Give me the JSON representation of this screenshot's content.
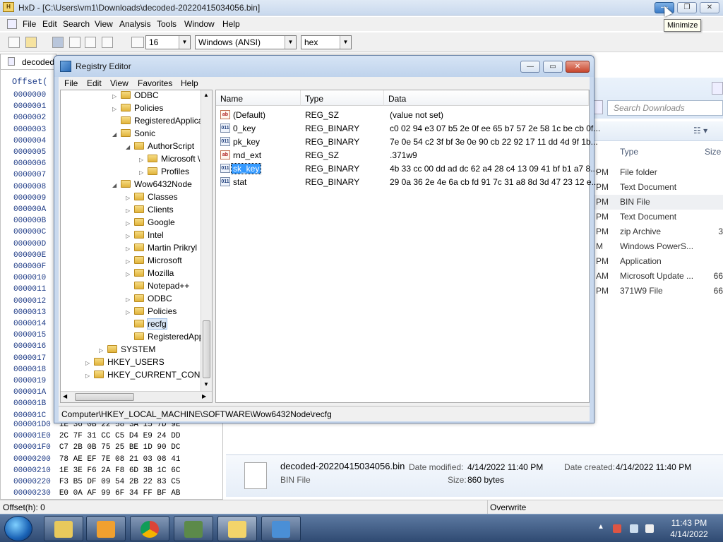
{
  "hxd": {
    "title": "HxD - [C:\\Users\\vm1\\Downloads\\decoded-20220415034056.bin]",
    "logo_text": "HxD",
    "menu": [
      "File",
      "Edit",
      "Search",
      "View",
      "Analysis",
      "Tools",
      "Window",
      "Help"
    ],
    "toolbar": {
      "bytes_per_row": "16",
      "charset": "Windows (ANSI)",
      "display": "hex"
    },
    "tab_label": "decoded",
    "offset_header": "Offset(",
    "offsets": [
      "0000000",
      "0000001",
      "0000002",
      "0000003",
      "0000004",
      "0000005",
      "0000006",
      "0000007",
      "0000008",
      "0000009",
      "000000A",
      "000000B",
      "000000C",
      "000000D",
      "000000E",
      "000000F",
      "0000010",
      "0000011",
      "0000012",
      "0000013",
      "0000014",
      "0000015",
      "0000016",
      "0000017",
      "0000018",
      "0000019",
      "000001A",
      "000001B",
      "000001C"
    ],
    "hex_rows": [
      {
        "off": "000001D0",
        "bytes": "1E 36 0B 22 58 3A 15 7D 9E"
      },
      {
        "off": "000001E0",
        "bytes": "2C 7F 31 CC C5 D4 E9 24 DD"
      },
      {
        "off": "000001F0",
        "bytes": "C7 2B 0B 75 25 BE 1D 90 DC"
      },
      {
        "off": "00000200",
        "bytes": "78 AE EF 7E 08 21 03 08 41"
      },
      {
        "off": "00000210",
        "bytes": "1E 3E F6 2A F8 6D 3B 1C 6C"
      },
      {
        "off": "00000220",
        "bytes": "F3 B5 DF 09 54 2B 22 83 C5"
      },
      {
        "off": "00000230",
        "bytes": "E0 0A AF 99 6F 34 FF BF AB"
      }
    ],
    "status_offset": "Offset(h): 0",
    "status_mode": "Overwrite",
    "tooltip": "Minimize"
  },
  "explorer": {
    "search_placeholder": "Search Downloads",
    "col_type": "Type",
    "col_size": "Size",
    "rows": [
      {
        "time": "PM",
        "type": "File folder",
        "size": ""
      },
      {
        "time": "PM",
        "type": "Text Document",
        "size": ""
      },
      {
        "time": "PM",
        "type": "BIN File",
        "size": ""
      },
      {
        "time": "PM",
        "type": "Text Document",
        "size": ""
      },
      {
        "time": "PM",
        "type": "zip Archive",
        "size": "3"
      },
      {
        "time": "M",
        "type": "Windows PowerS...",
        "size": ""
      },
      {
        "time": "PM",
        "type": "Application",
        "size": ""
      },
      {
        "time": "AM",
        "type": "Microsoft Update ...",
        "size": "66"
      },
      {
        "time": "PM",
        "type": "371W9 File",
        "size": "66"
      }
    ],
    "details": {
      "filename": "decoded-20220415034056.bin",
      "filetype": "BIN File",
      "modified_label": "Date modified:",
      "modified": "4/14/2022 11:40 PM",
      "created_label": "Date created:",
      "created": "4/14/2022 11:40 PM",
      "size_label": "Size:",
      "size": "860 bytes"
    }
  },
  "registry": {
    "title": "Registry Editor",
    "menu": [
      "File",
      "Edit",
      "View",
      "Favorites",
      "Help"
    ],
    "tree": [
      {
        "label": "ODBC",
        "indent": 1,
        "arrow": "▷"
      },
      {
        "label": "Policies",
        "indent": 1,
        "arrow": "▷"
      },
      {
        "label": "RegisteredApplica",
        "indent": 1,
        "arrow": ""
      },
      {
        "label": "Sonic",
        "indent": 1,
        "arrow": "◢"
      },
      {
        "label": "AuthorScript",
        "indent": 2,
        "arrow": "◢"
      },
      {
        "label": "Microsoft \\",
        "indent": 3,
        "arrow": "▷"
      },
      {
        "label": "Profiles",
        "indent": 3,
        "arrow": "▷"
      },
      {
        "label": "Wow6432Node",
        "indent": 1,
        "arrow": "◢"
      },
      {
        "label": "Classes",
        "indent": 2,
        "arrow": "▷"
      },
      {
        "label": "Clients",
        "indent": 2,
        "arrow": "▷"
      },
      {
        "label": "Google",
        "indent": 2,
        "arrow": "▷"
      },
      {
        "label": "Intel",
        "indent": 2,
        "arrow": "▷"
      },
      {
        "label": "Martin Prikryl",
        "indent": 2,
        "arrow": "▷"
      },
      {
        "label": "Microsoft",
        "indent": 2,
        "arrow": "▷"
      },
      {
        "label": "Mozilla",
        "indent": 2,
        "arrow": "▷"
      },
      {
        "label": "Notepad++",
        "indent": 2,
        "arrow": ""
      },
      {
        "label": "ODBC",
        "indent": 2,
        "arrow": "▷"
      },
      {
        "label": "Policies",
        "indent": 2,
        "arrow": "▷"
      },
      {
        "label": "recfg",
        "indent": 2,
        "arrow": "",
        "selected": true
      },
      {
        "label": "RegisteredApp",
        "indent": 2,
        "arrow": ""
      },
      {
        "label": "SYSTEM",
        "indent": 0,
        "arrow": "▷"
      },
      {
        "label": "HKEY_USERS",
        "indent": -1,
        "arrow": "▷"
      },
      {
        "label": "HKEY_CURRENT_CONFIG",
        "indent": -1,
        "arrow": "▷"
      }
    ],
    "columns": [
      "Name",
      "Type",
      "Data"
    ],
    "values": [
      {
        "icon": "ab",
        "name": "(Default)",
        "type": "REG_SZ",
        "data": "(value not set)"
      },
      {
        "icon": "011",
        "name": "0_key",
        "type": "REG_BINARY",
        "data": "c0 02 94 e3 07 b5 2e 0f ee 65 b7 57 2e 58 1c be cb 0f..."
      },
      {
        "icon": "011",
        "name": "pk_key",
        "type": "REG_BINARY",
        "data": "7e 0e 54 c2 3f bf 3e 0e 90 cb 22 92 17 11 dd 4d 9f 1b..."
      },
      {
        "icon": "ab",
        "name": "rnd_ext",
        "type": "REG_SZ",
        "data": ".371w9"
      },
      {
        "icon": "011",
        "name": "sk_key",
        "type": "REG_BINARY",
        "data": "4b 33 cc 00 dd ad dc 62 a4 28 c4 13 09 41 bf b1 a7 8...",
        "selected": true
      },
      {
        "icon": "011",
        "name": "stat",
        "type": "REG_BINARY",
        "data": "29 0a 36 2e 4e 6a cb fd 91 7c 31 a8 8d 3d 47 23 12 e..."
      }
    ],
    "status": "Computer\\HKEY_LOCAL_MACHINE\\SOFTWARE\\Wow6432Node\\recfg"
  },
  "taskbar": {
    "time": "11:43 PM",
    "date": "4/14/2022"
  }
}
